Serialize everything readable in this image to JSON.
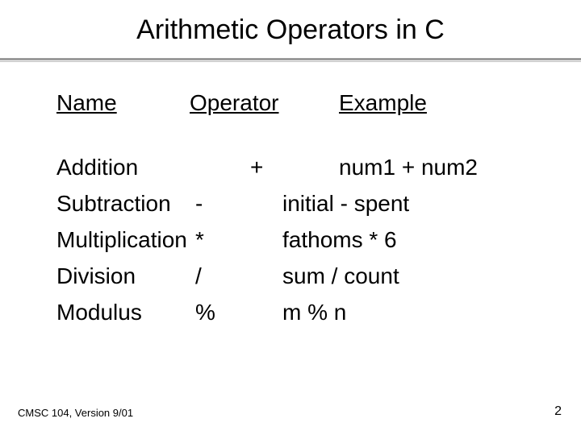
{
  "title": "Arithmetic Operators in C",
  "headers": {
    "name": "Name",
    "operator": "Operator",
    "example": "Example"
  },
  "rows": [
    {
      "name": "Addition",
      "operator": "+",
      "example": "num1 + num2"
    },
    {
      "name": "Subtraction",
      "operator": "-",
      "example": "initial - spent"
    },
    {
      "name": "Multiplication",
      "operator": "*",
      "example": "fathoms * 6"
    },
    {
      "name": "Division",
      "operator": "/",
      "example": "sum / count"
    },
    {
      "name": "Modulus",
      "operator": "%",
      "example": "m % n"
    }
  ],
  "footer": {
    "left": "CMSC 104, Version 9/01",
    "page": "2"
  }
}
